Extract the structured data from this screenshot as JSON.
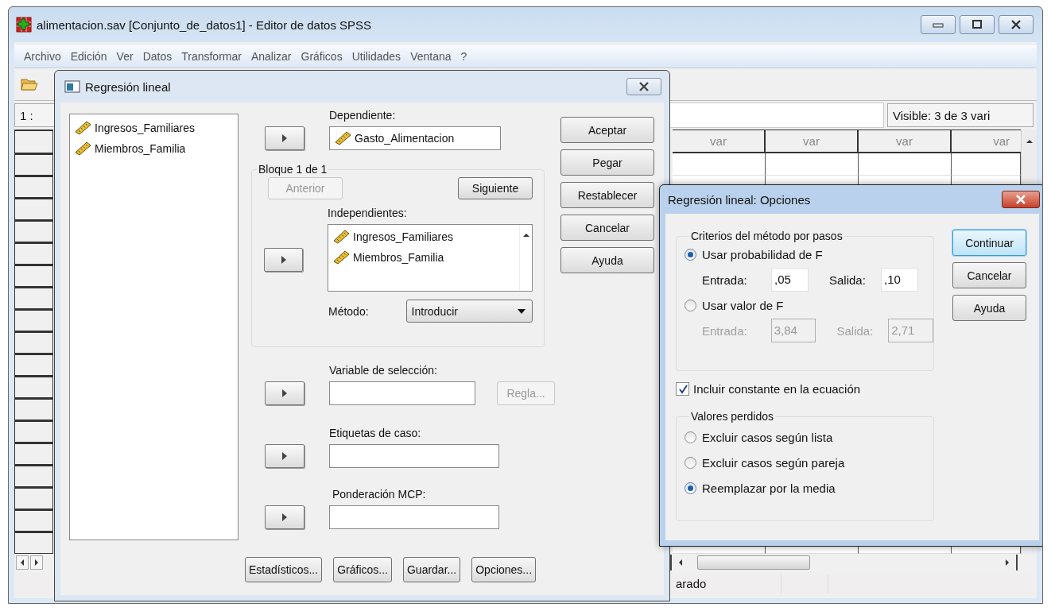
{
  "window": {
    "title": "alimentacion.sav [Conjunto_de_datos1] - Editor de datos SPSS"
  },
  "menu": [
    "Archivo",
    "Edición",
    "Ver",
    "Datos",
    "Transformar",
    "Analizar",
    "Gráficos",
    "Utilidades",
    "Ventana",
    "?"
  ],
  "cell_ref": "1 :",
  "visible_info": "Visible: 3 de 3 vari",
  "grid": {
    "columns": [
      "var",
      "var",
      "var",
      "var"
    ]
  },
  "status_bar": "arado",
  "regression_dialog": {
    "title": "Regresión lineal",
    "source_variables": [
      "Ingresos_Familiares",
      "Miembros_Familia"
    ],
    "dependent_label": "Dependiente:",
    "dependent_value": "Gasto_Alimentacion",
    "block": {
      "legend": "Bloque 1 de 1",
      "previous": {
        "label": "Anterior",
        "disabled": true
      },
      "next": {
        "label": "Siguiente",
        "disabled": false
      },
      "independents_label": "Independientes:",
      "independents": [
        "Ingresos_Familiares",
        "Miembros_Familia"
      ],
      "method_label": "Método:",
      "method": "Introducir"
    },
    "selection_label": "Variable de selección:",
    "rule_button": {
      "label": "Regla...",
      "disabled": true
    },
    "case_labels_label": "Etiquetas de caso:",
    "wls_label": "Ponderación MCP:",
    "side_buttons": [
      "Aceptar",
      "Pegar",
      "Restablecer",
      "Cancelar",
      "Ayuda"
    ],
    "bottom_buttons": [
      "Estadísticos...",
      "Gráficos...",
      "Guardar...",
      "Opciones..."
    ]
  },
  "options_dialog": {
    "title": "Regresión lineal: Opciones",
    "stepping": {
      "legend": "Criterios del método por pasos",
      "options": [
        {
          "label": "Usar probabilidad de F",
          "selected": true,
          "entry_label": "Entrada:",
          "entry": ",05",
          "removal_label": "Salida:",
          "removal": ",10"
        },
        {
          "label": "Usar valor de F",
          "selected": false,
          "entry_label": "Entrada:",
          "entry": "3,84",
          "removal_label": "Salida:",
          "removal": "2,71"
        }
      ]
    },
    "include_constant": {
      "label": "Incluir constante en la ecuación",
      "checked": true
    },
    "missing": {
      "legend": "Valores perdidos",
      "options": [
        {
          "label": "Excluir casos según lista",
          "selected": false
        },
        {
          "label": "Excluir casos según pareja",
          "selected": false
        },
        {
          "label": "Reemplazar por la media",
          "selected": true
        }
      ]
    },
    "buttons": [
      {
        "label": "Continuar",
        "default": true
      },
      {
        "label": "Cancelar",
        "default": false
      },
      {
        "label": "Ayuda",
        "default": false
      }
    ]
  }
}
